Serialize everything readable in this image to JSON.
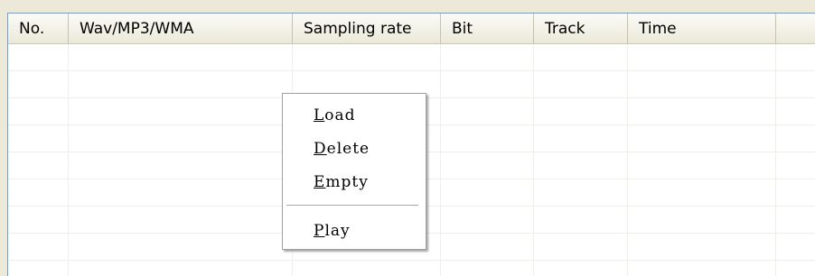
{
  "table": {
    "columns": [
      "No.",
      "Wav/MP3/WMA",
      "Sampling rate",
      "Bit",
      "Track",
      "Time"
    ],
    "rows": []
  },
  "context_menu": {
    "items": [
      {
        "mnemonic": "L",
        "rest": "oad",
        "label": "Load"
      },
      {
        "mnemonic": "D",
        "rest": "elete",
        "label": "Delete"
      },
      {
        "mnemonic": "E",
        "rest": "mpty",
        "label": "Empty"
      },
      {
        "mnemonic": "P",
        "rest": "lay",
        "label": "Play"
      }
    ]
  }
}
